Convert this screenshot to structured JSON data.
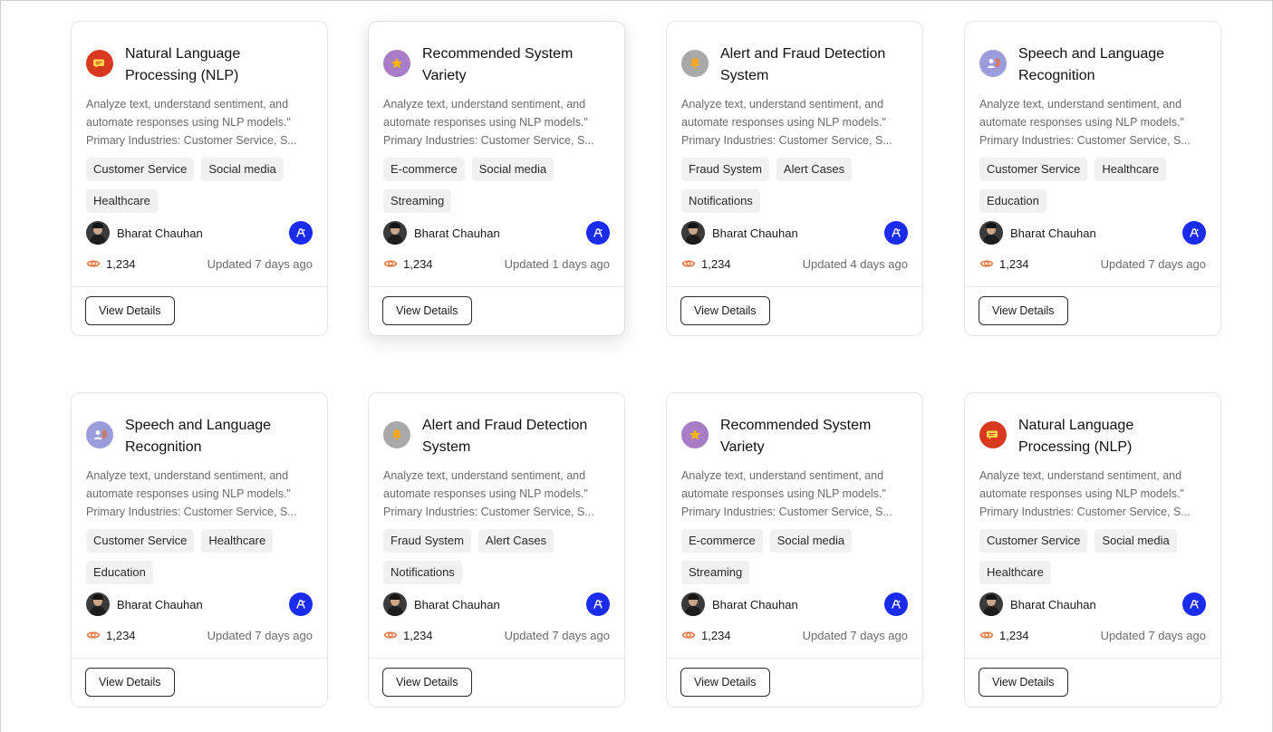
{
  "colors": {
    "ai_badge": "#1a2cf0",
    "views_icon": "#e8703a",
    "nlp_icon_bg": "#d93a1f",
    "recommend_icon_bg": "#a87cc6",
    "alert_icon_bg": "#a9a9a9",
    "speech_icon_bg": "#9b9cdc"
  },
  "cards": [
    {
      "icon": "chat-bubble-icon",
      "title_line1": "Natural Language",
      "title_line2": "Processing (NLP)",
      "desc": [
        "Analyze text, understand sentiment, and",
        "automate responses using NLP models.\"",
        "Primary Industries: Customer Service, S..."
      ],
      "tags": [
        "Customer Service",
        "Social media",
        "Healthcare"
      ],
      "author": "Bharat Chauhan",
      "views": "1,234",
      "updated": "Updated 7 days ago",
      "button": "View Details"
    },
    {
      "icon": "star-icon",
      "title_line1": "Recommended System",
      "title_line2": "Variety",
      "desc": [
        "Analyze text, understand sentiment, and",
        "automate responses using NLP models.\"",
        "Primary Industries: Customer Service, S..."
      ],
      "tags": [
        "E-commerce",
        "Social media",
        "Streaming"
      ],
      "author": "Bharat Chauhan",
      "views": "1,234",
      "updated": "Updated 1 days ago",
      "button": "View Details"
    },
    {
      "icon": "bell-icon",
      "title_line1": "Alert and Fraud Detection",
      "title_line2": "System",
      "desc": [
        "Analyze text, understand sentiment, and",
        "automate responses using NLP models.\"",
        "Primary Industries: Customer Service, S..."
      ],
      "tags": [
        "Fraud System",
        "Alert Cases",
        "Notifications"
      ],
      "author": "Bharat Chauhan",
      "views": "1,234",
      "updated": "Updated 4 days ago",
      "button": "View Details"
    },
    {
      "icon": "speech-user-icon",
      "title_line1": "Speech and Language",
      "title_line2": "Recognition",
      "desc": [
        "Analyze text, understand sentiment, and",
        "automate responses using NLP models.\"",
        "Primary Industries: Customer Service, S..."
      ],
      "tags": [
        "Customer Service",
        "Healthcare",
        "Education"
      ],
      "author": "Bharat Chauhan",
      "views": "1,234",
      "updated": "Updated 7 days ago",
      "button": "View Details"
    },
    {
      "icon": "speech-user-icon",
      "title_line1": "Speech and Language",
      "title_line2": "Recognition",
      "desc": [
        "Analyze text, understand sentiment, and",
        "automate responses using NLP models.\"",
        "Primary Industries: Customer Service, S..."
      ],
      "tags": [
        "Customer Service",
        "Healthcare",
        "Education"
      ],
      "author": "Bharat Chauhan",
      "views": "1,234",
      "updated": "Updated 7 days ago",
      "button": "View Details"
    },
    {
      "icon": "bell-icon",
      "title_line1": "Alert and Fraud Detection",
      "title_line2": "System",
      "desc": [
        "Analyze text, understand sentiment, and",
        "automate responses using NLP models.\"",
        "Primary Industries: Customer Service, S..."
      ],
      "tags": [
        "Fraud System",
        "Alert Cases",
        "Notifications"
      ],
      "author": "Bharat Chauhan",
      "views": "1,234",
      "updated": "Updated 7 days ago",
      "button": "View Details"
    },
    {
      "icon": "star-icon",
      "title_line1": "Recommended System",
      "title_line2": "Variety",
      "desc": [
        "Analyze text, understand sentiment, and",
        "automate responses using NLP models.\"",
        "Primary Industries: Customer Service, S..."
      ],
      "tags": [
        "E-commerce",
        "Social media",
        "Streaming"
      ],
      "author": "Bharat Chauhan",
      "views": "1,234",
      "updated": "Updated 7 days ago",
      "button": "View Details"
    },
    {
      "icon": "chat-bubble-icon",
      "title_line1": "Natural Language",
      "title_line2": "Processing (NLP)",
      "desc": [
        "Analyze text, understand sentiment, and",
        "automate responses using NLP models.\"",
        "Primary Industries: Customer Service, S..."
      ],
      "tags": [
        "Customer Service",
        "Social media",
        "Healthcare"
      ],
      "author": "Bharat Chauhan",
      "views": "1,234",
      "updated": "Updated 7 days ago",
      "button": "View Details"
    }
  ]
}
